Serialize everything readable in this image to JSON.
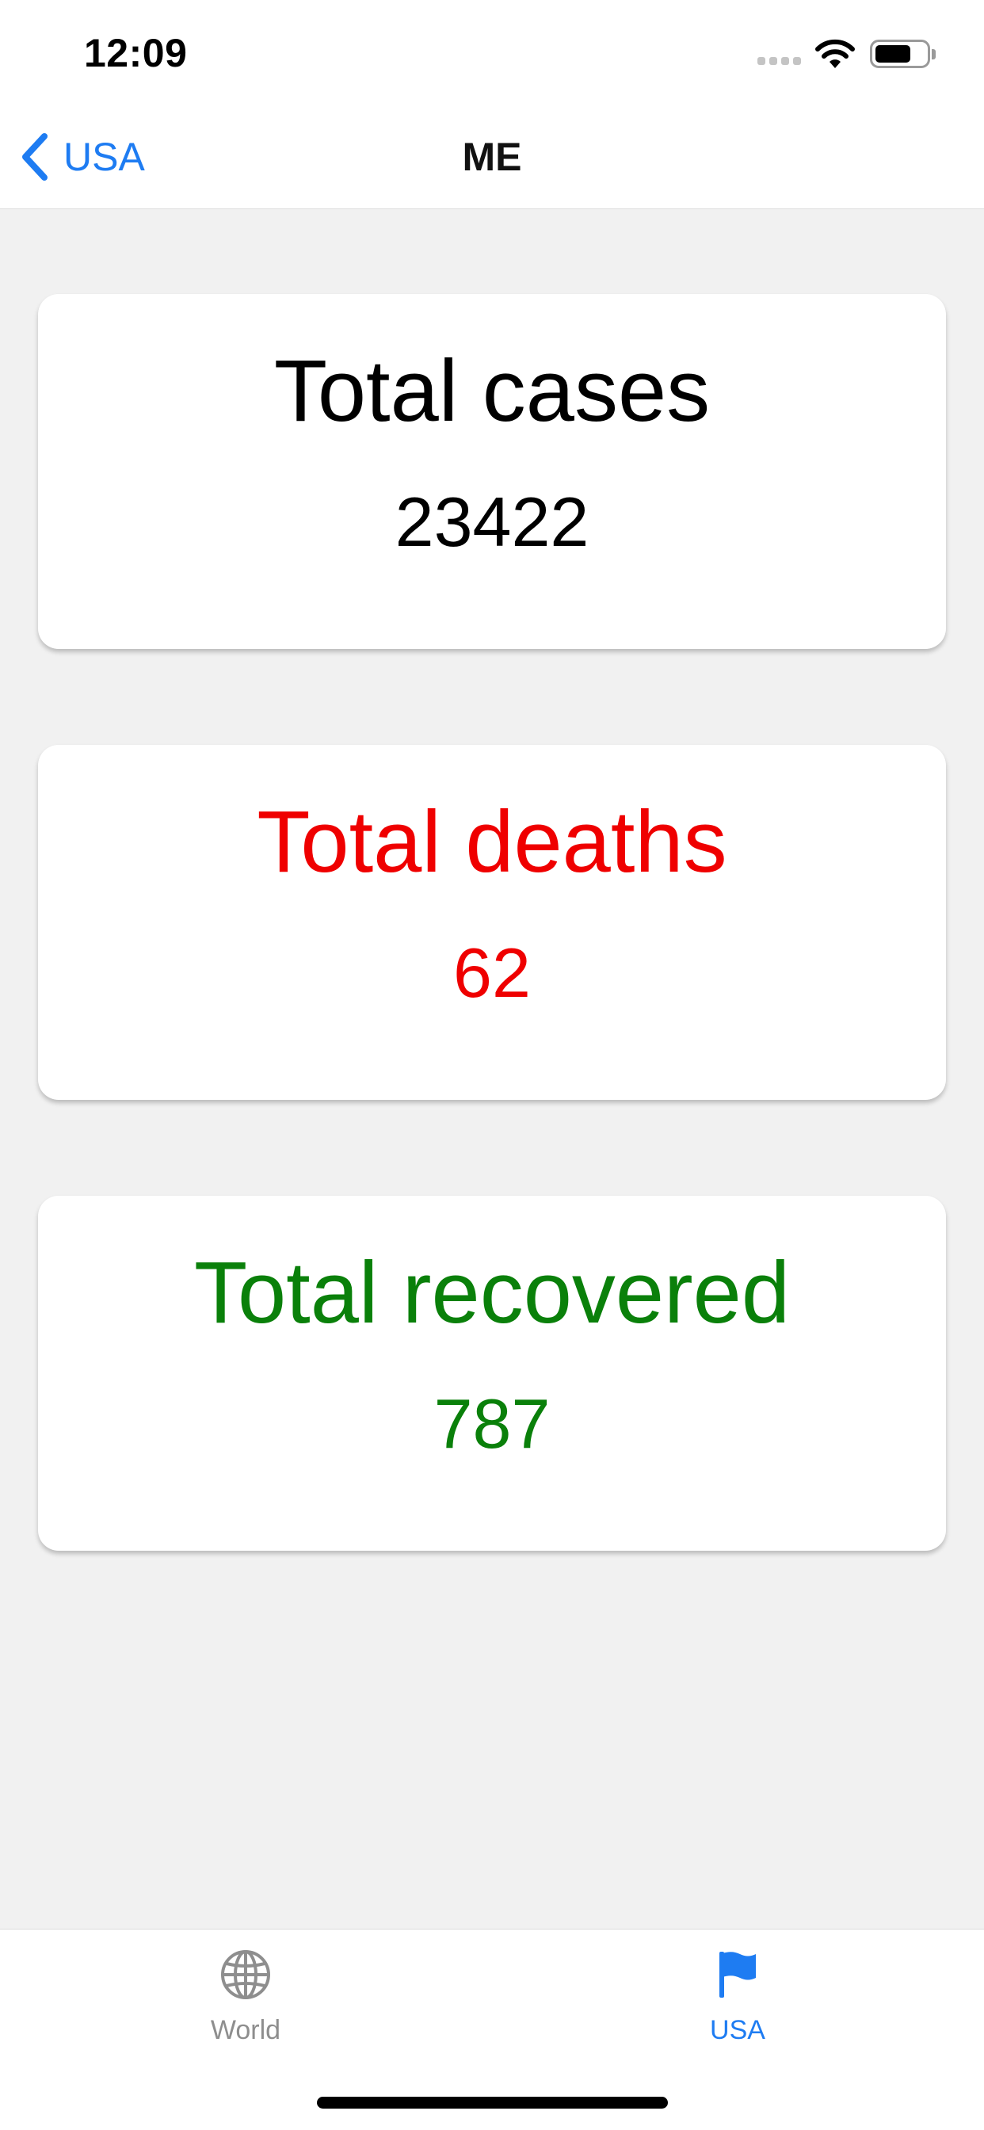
{
  "status_bar": {
    "time": "12:09"
  },
  "nav": {
    "back_label": "USA",
    "title": "ME",
    "accent_color": "#1e7cf2"
  },
  "cards": [
    {
      "title": "Total cases",
      "value": "23422",
      "color": "#000000"
    },
    {
      "title": "Total deaths",
      "value": "62",
      "color": "#ef0000"
    },
    {
      "title": "Total recovered",
      "value": "787",
      "color": "#0a800a"
    }
  ],
  "tabs": [
    {
      "label": "World",
      "icon": "globe-icon",
      "selected": false,
      "color": "#8e8e8e"
    },
    {
      "label": "USA",
      "icon": "flag-icon",
      "selected": true,
      "color": "#1e7cf2"
    }
  ]
}
